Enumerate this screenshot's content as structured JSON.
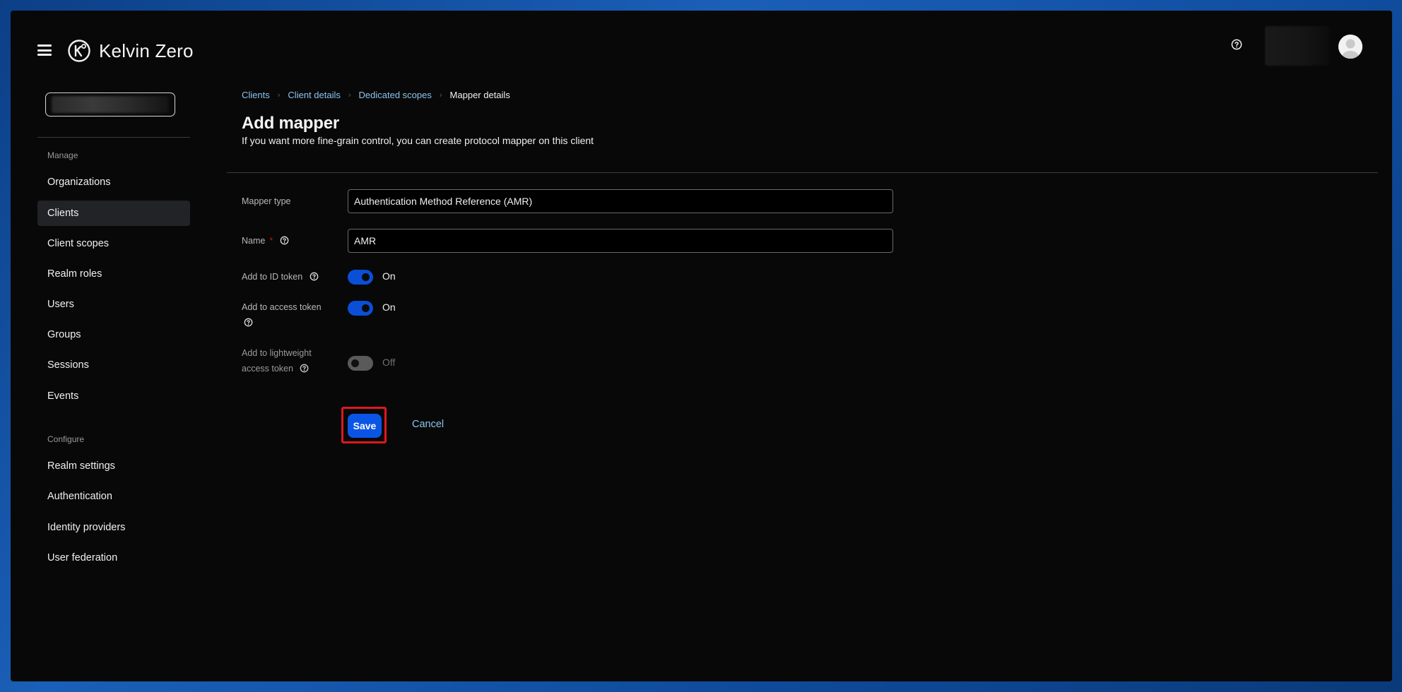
{
  "app": {
    "brand_name": "Kelvin Zero"
  },
  "sidebar": {
    "sections": [
      {
        "title": "Manage",
        "items": [
          "Organizations",
          "Clients",
          "Client scopes",
          "Realm roles",
          "Users",
          "Groups",
          "Sessions",
          "Events"
        ]
      },
      {
        "title": "Configure",
        "items": [
          "Realm settings",
          "Authentication",
          "Identity providers",
          "User federation"
        ]
      }
    ],
    "active_item": "Clients"
  },
  "breadcrumb": {
    "items": [
      "Clients",
      "Client details",
      "Dedicated scopes"
    ],
    "current": "Mapper details"
  },
  "page": {
    "title": "Add mapper",
    "subtitle": "If you want more fine-grain control, you can create protocol mapper on this client"
  },
  "form": {
    "mapper_type": {
      "label": "Mapper type",
      "value": "Authentication Method Reference (AMR)"
    },
    "name": {
      "label": "Name",
      "required_marker": "*",
      "value": "AMR"
    },
    "add_to_id_token": {
      "label": "Add to ID token",
      "state": "On",
      "enabled": true
    },
    "add_to_access_token": {
      "label": "Add to access token",
      "state": "On",
      "enabled": true
    },
    "add_to_lightweight_access_token": {
      "label_line1": "Add to lightweight",
      "label_line2": "access token",
      "state": "Off",
      "enabled": false
    }
  },
  "actions": {
    "save_label": "Save",
    "cancel_label": "Cancel"
  },
  "colors": {
    "accent": "#0a55e6",
    "link": "#8cc4ee",
    "highlight": "#e0181e",
    "background": "#080808"
  }
}
